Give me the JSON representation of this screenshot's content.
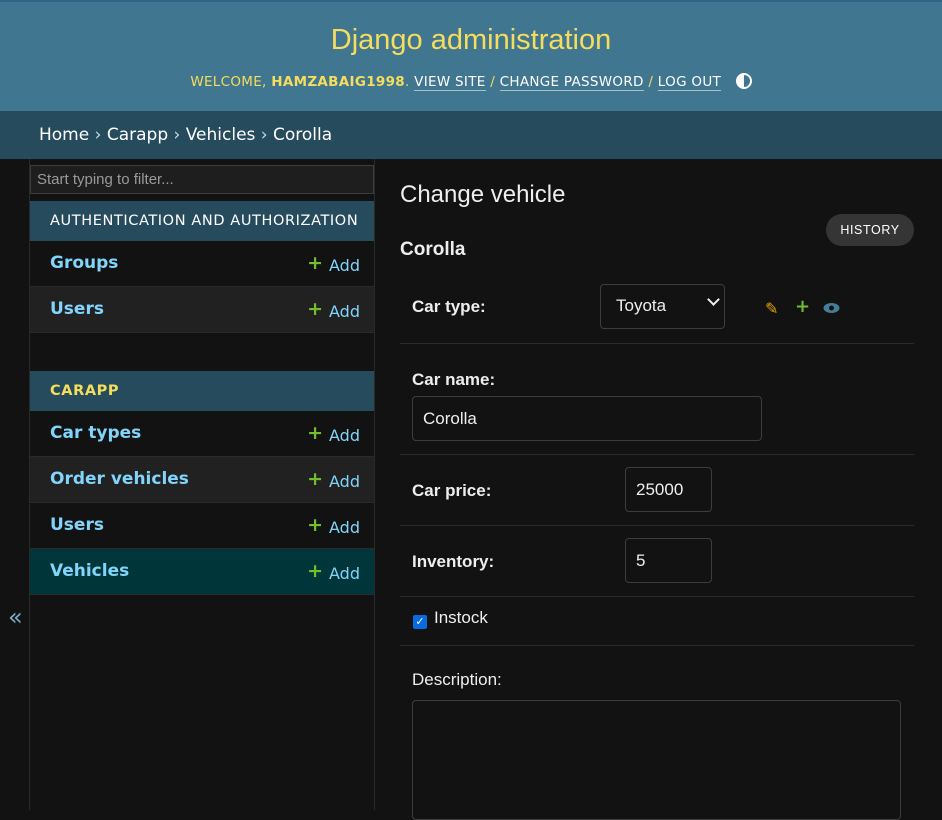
{
  "header": {
    "site_title": "Django administration",
    "welcome": "WELCOME,",
    "username": "HAMZABAIG1998",
    "view_site": "VIEW SITE",
    "change_password": "CHANGE PASSWORD",
    "log_out": "LOG OUT",
    "separator": "/"
  },
  "breadcrumbs": {
    "home": "Home",
    "app": "Carapp",
    "model": "Vehicles",
    "current": "Corolla",
    "separator": "›"
  },
  "sidebar": {
    "toggle_glyph": "«",
    "filter_placeholder": "Start typing to filter...",
    "modules": [
      {
        "caption": "AUTHENTICATION AND AUTHORIZATION",
        "models": [
          {
            "name": "Groups",
            "add": "Add"
          },
          {
            "name": "Users",
            "add": "Add"
          }
        ]
      },
      {
        "caption": "CARAPP",
        "models": [
          {
            "name": "Car types",
            "add": "Add"
          },
          {
            "name": "Order vehicles",
            "add": "Add"
          },
          {
            "name": "Users",
            "add": "Add"
          },
          {
            "name": "Vehicles",
            "add": "Add",
            "current": true
          }
        ]
      }
    ],
    "add_glyph": "+"
  },
  "main": {
    "heading": "Change vehicle",
    "history_button": "HISTORY",
    "object_name": "Corolla",
    "fields": {
      "car_type": {
        "label": "Car type:",
        "value": "Toyota"
      },
      "car_name": {
        "label": "Car name:",
        "value": "Corolla"
      },
      "car_price": {
        "label": "Car price:",
        "value": "25000"
      },
      "inventory": {
        "label": "Inventory:",
        "value": "5"
      },
      "instock": {
        "label": "Instock",
        "checked": true
      },
      "description": {
        "label": "Description:",
        "value": ""
      }
    },
    "related_icons": [
      "pencil-icon",
      "plus-icon",
      "eye-icon"
    ]
  },
  "colors": {
    "header_bg": "#417690",
    "title_yellow": "#f5dd5d",
    "breadcrumb_bg": "#264b5d",
    "link_blue": "#81d4fa",
    "add_green": "#70bf2b",
    "current_row": "#00363a",
    "page_bg": "#121212"
  }
}
